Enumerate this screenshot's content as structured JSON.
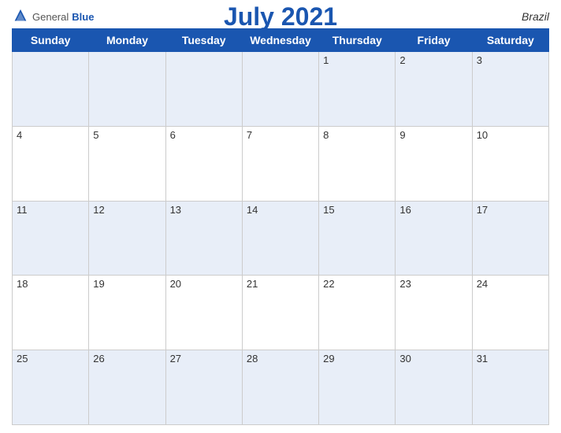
{
  "header": {
    "logo_general": "General",
    "logo_blue": "Blue",
    "title": "July 2021",
    "country": "Brazil"
  },
  "weekdays": [
    "Sunday",
    "Monday",
    "Tuesday",
    "Wednesday",
    "Thursday",
    "Friday",
    "Saturday"
  ],
  "weeks": [
    [
      null,
      null,
      null,
      null,
      1,
      2,
      3
    ],
    [
      4,
      5,
      6,
      7,
      8,
      9,
      10
    ],
    [
      11,
      12,
      13,
      14,
      15,
      16,
      17
    ],
    [
      18,
      19,
      20,
      21,
      22,
      23,
      24
    ],
    [
      25,
      26,
      27,
      28,
      29,
      30,
      31
    ]
  ]
}
